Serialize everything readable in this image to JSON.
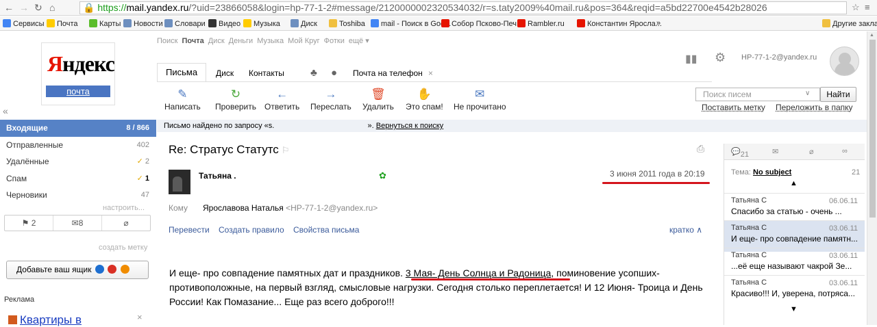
{
  "browser": {
    "url_https": "https://",
    "url_domain": "mail.yandex.ru",
    "url_rest": "/?uid=23866058&login=hp-77-1-2#message/2120000002320534032/r=s.taty2009%40mail.ru&pos=364&reqid=a5bd22700e4542b28026",
    "bookmarks": [
      {
        "label": "Сервисы",
        "color": "#4285f4"
      },
      {
        "label": "Почта",
        "color": "#ffcc00"
      },
      {
        "label": "Карты",
        "color": "#5bbd2b"
      },
      {
        "label": "Новости",
        "color": "#6d8fbf"
      },
      {
        "label": "Словари",
        "color": "#6d8fbf"
      },
      {
        "label": "Видео",
        "color": "#333333"
      },
      {
        "label": "Музыка",
        "color": "#ffcc00"
      },
      {
        "label": "Диск",
        "color": "#6d8fbf"
      },
      {
        "label": "Toshiba",
        "color": "#f0c040"
      },
      {
        "label": "mail - Поиск в Goo...",
        "color": "#4285f4"
      },
      {
        "label": "Собор Псково-Печ...",
        "color": "#e61400"
      },
      {
        "label": "Rambler.ru",
        "color": "#e61400"
      },
      {
        "label": "Константин Яросла...",
        "color": "#e61400"
      },
      {
        "label": "»",
        "color": ""
      },
      {
        "label": "Другие закладки",
        "color": "#f0c040"
      }
    ]
  },
  "logo": {
    "brand_first": "Я",
    "brand_rest": "ндекс",
    "service": "почта"
  },
  "services": [
    "Поиск",
    "Почта",
    "Диск",
    "Деньги",
    "Музыка",
    "Мой Круг",
    "Фотки",
    "ещё ▾"
  ],
  "user": {
    "email": "HP-77-1-2@yandex.ru"
  },
  "tabs": [
    "Письма",
    "Диск",
    "Контакты",
    "Почта на телефон",
    "×"
  ],
  "toolbar": [
    {
      "label": "Написать",
      "icon": "compose-icon",
      "glyph": "✎",
      "color": "#4a78c0"
    },
    {
      "label": "Проверить",
      "icon": "refresh-icon",
      "glyph": "↻",
      "color": "#4aa83a"
    },
    {
      "label": "Ответить",
      "icon": "reply-icon",
      "glyph": "←",
      "color": "#4a78c0"
    },
    {
      "label": "Переслать",
      "icon": "forward-icon",
      "glyph": "→",
      "color": "#4a78c0"
    },
    {
      "label": "Удалить",
      "icon": "trash-icon",
      "glyph": "🗑",
      "color": "#e04a2a"
    },
    {
      "label": "Это спам!",
      "icon": "spam-icon",
      "glyph": "✋",
      "color": "#f0a000"
    },
    {
      "label": "Не прочитано",
      "icon": "envelope-icon",
      "glyph": "✉",
      "color": "#4a78c0"
    }
  ],
  "search": {
    "placeholder": "Поиск писем",
    "button": "Найти",
    "link_label": "Поставить метку",
    "link_move": "Переложить в папку"
  },
  "folders": [
    {
      "name": "Входящие",
      "count": "8 / 866",
      "active": true
    },
    {
      "name": "Отправленные",
      "count": "402"
    },
    {
      "name": "Удалённые",
      "count": "2",
      "tick": true
    },
    {
      "name": "Спам",
      "count": "1",
      "tick": true
    },
    {
      "name": "Черновики",
      "count": "47"
    }
  ],
  "folder_settings": "настроить...",
  "filters": {
    "flagged": "2",
    "unread": "8"
  },
  "create_label": "создать метку",
  "add_mailbox": "Добавьте ваш ящик",
  "ads": {
    "heading": "Реклама",
    "title": "Квартиры в"
  },
  "notice": {
    "text": "Письмо найдено по запросу «s.",
    "text2": "».",
    "link": "Вернуться к поиску"
  },
  "message": {
    "subject": "Re: Стратус Статутс",
    "sender": "Татьяна .",
    "date": "3 июня 2011 года в 20:19",
    "to_label": "Кому",
    "to_name": "Ярославова Наталья",
    "to_addr": "<HP-77-1-2@yandex.ru>",
    "actions": [
      "Перевести",
      "Создать правило",
      "Свойства письма"
    ],
    "brief": "кратко",
    "body_1": "И еще- про совпадение памятных дат и праздников. ",
    "body_highlight": "3 Мая- День Солнца и Радоница",
    "body_2": ", поминовение усопших- противоположные, на первый взгляд, смысловые нагрузки. Сегодня столько переплетается! И 12 Июня- Троица и День России! Как Помазание...    Еще раз всего доброго!!!"
  },
  "thread": {
    "count_tab": "21",
    "subject_label": "Тема:",
    "subject": "No subject",
    "count": "21",
    "items": [
      {
        "from": "Татьяна С",
        "date": "06.06.11",
        "snippet": "Спасибо за статью - очень ..."
      },
      {
        "from": "Татьяна С",
        "date": "03.06.11",
        "snippet": "И еще- про совпадение памятн...",
        "active": true
      },
      {
        "from": "Татьяна С",
        "date": "03.06.11",
        "snippet": "...её еще называют чакрой Зе..."
      },
      {
        "from": "Татьяна С",
        "date": "03.06.11",
        "snippet": "Красиво!!! И, уверена, потряса..."
      }
    ]
  }
}
